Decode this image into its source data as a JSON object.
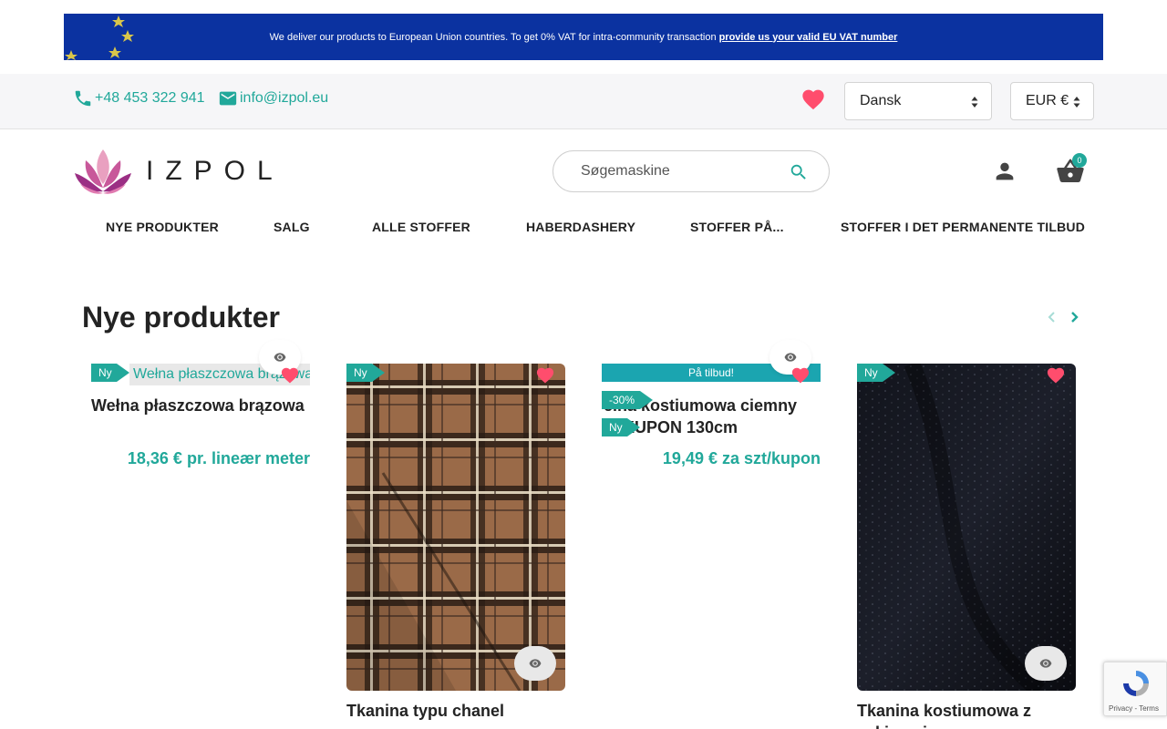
{
  "banner": {
    "text": "We deliver our products to European Union countries. To get 0% VAT for intra-community transaction",
    "link": "provide us your valid EU VAT number"
  },
  "contact": {
    "phone": "+48 453 322 941",
    "email": "info@izpol.eu"
  },
  "language": {
    "selected": "Dansk"
  },
  "currency": {
    "selected": "EUR €"
  },
  "logo": {
    "text": "IZPOL"
  },
  "search": {
    "placeholder": "Søgemaskine"
  },
  "cart": {
    "count": "0"
  },
  "menu": [
    "NYE PRODUKTER",
    "SALG",
    "ALLE STOFFER",
    "HABERDASHERY",
    "STOFFER PÅ...",
    "STOFFER I DET PERMANENTE TILBUD"
  ],
  "section": {
    "title": "Nye produkter"
  },
  "products": [
    {
      "title": "Wełna płaszczowa brązowa",
      "alt": "Wełna płaszczowa brązowa",
      "price": "18,36 € pr. lineær meter",
      "badge_new": "Ny"
    },
    {
      "title": "Tkanina typu chanel",
      "badge_new": "Ny"
    },
    {
      "title": "Wełna kostiumowa ciemny granat KUPON 130cm",
      "title_visible": "ełna kostiumowa ciemny\nat KUPON 130cm",
      "price": "19,49 € za szt/kupon",
      "badge_new": "Ny",
      "badge_offer": "På tilbud!",
      "badge_discount": "-30%"
    },
    {
      "title": "Tkanina kostiumowa z cekinami czarna",
      "badge_new": "Ny"
    }
  ],
  "recaptcha": {
    "links": "Privacy - Terms"
  },
  "colors": {
    "accent": "#21a89a",
    "banner": "#0b32a0",
    "heart": "#ff4d6d"
  }
}
